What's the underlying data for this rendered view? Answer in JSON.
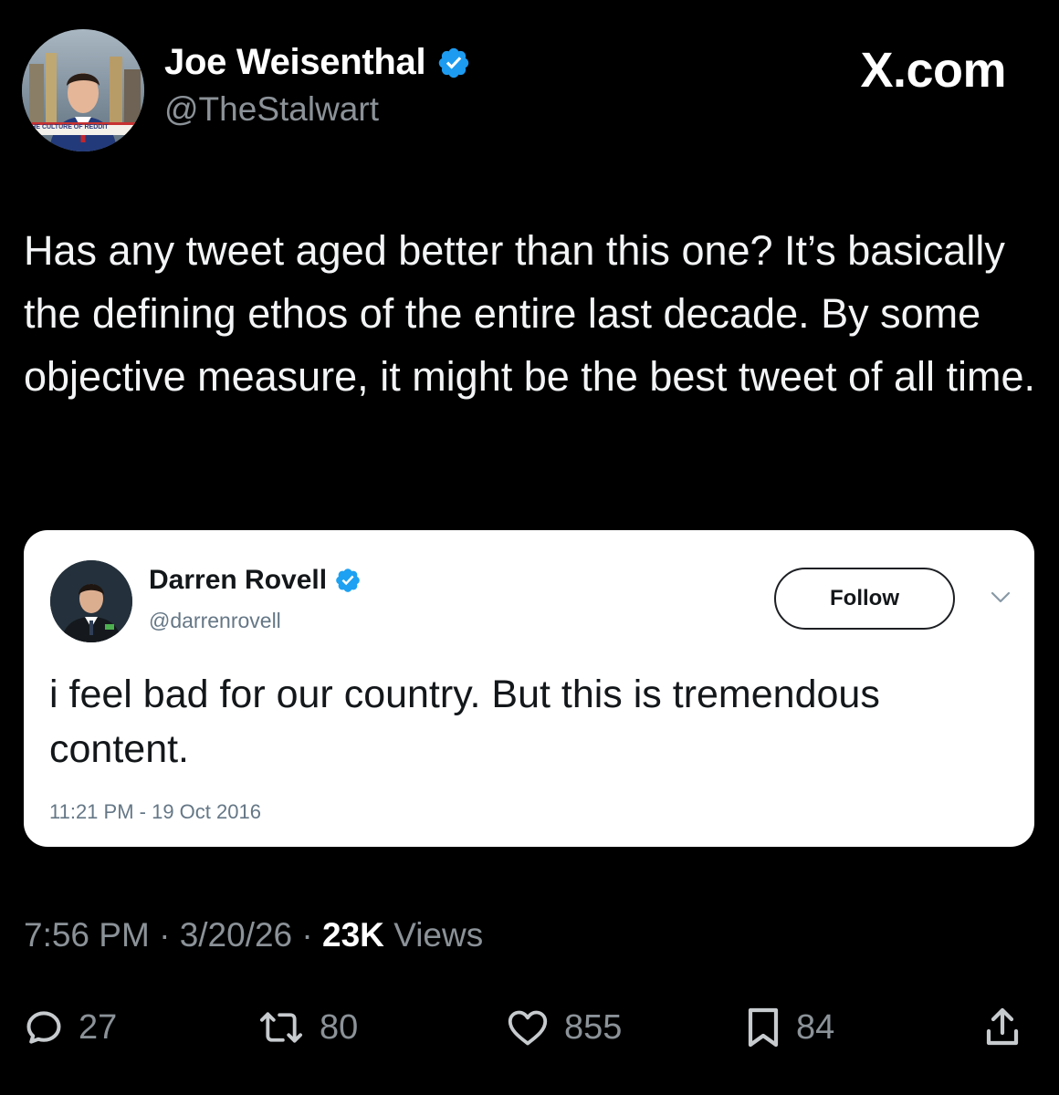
{
  "author": {
    "name": "Joe Weisenthal",
    "handle": "@TheStalwart",
    "avatar_caption": "THE CULTURE OF REDDIT"
  },
  "site": "X.com",
  "tweet": {
    "text": "Has any tweet aged better than this one? It’s basically the defining ethos of the entire last decade. By some objective measure, it might be the best tweet of all time."
  },
  "quoted": {
    "name": "Darren Rovell",
    "handle": "@darrenrovell",
    "follow_label": "Follow",
    "text": "i feel bad for our country. But this is tremendous content.",
    "timestamp": "11:21 PM - 19 Oct 2016"
  },
  "meta": {
    "time": "7:56 PM",
    "date": "3/20/26",
    "views_count": "23K",
    "views_label": "Views"
  },
  "actions": {
    "replies": "27",
    "reposts": "80",
    "likes": "855",
    "bookmarks": "84"
  },
  "icons": {
    "verified": "verified-badge-icon",
    "reply": "reply-icon",
    "repost": "repost-icon",
    "like": "heart-icon",
    "bookmark": "bookmark-icon",
    "share": "share-icon",
    "chevron": "chevron-down-icon"
  },
  "colors": {
    "background": "#000000",
    "verified": "#1d9bf0",
    "secondary_text": "#8b9298",
    "card_background": "#ffffff"
  }
}
